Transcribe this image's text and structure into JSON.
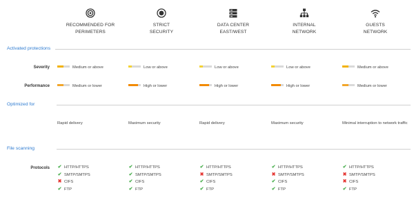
{
  "colors": {
    "accent": "#2e7bd0",
    "severity_fill": "#f2b200",
    "severity_fill_low": "#f4d233",
    "performance_fill": "#f2a62b",
    "performance_fill_high": "#f28a00",
    "yes": "#4caf50",
    "no": "#e53935"
  },
  "profiles": [
    {
      "icon": "target-icon",
      "title": "RECOMMENDED FOR\nPERIMETERS"
    },
    {
      "icon": "shield-circle-icon",
      "title": "STRICT\nSECURITY"
    },
    {
      "icon": "server-icon",
      "title": "DATA CENTER\nEAST/WEST"
    },
    {
      "icon": "network-hierarchy-icon",
      "title": "INTERNAL\nNETWORK"
    },
    {
      "icon": "wifi-icon",
      "title": "GUESTS\nNETWORK"
    }
  ],
  "sections": {
    "activated_protections": "Activated protections",
    "optimized_for": "Optimized for",
    "file_scanning": "File scanning"
  },
  "rows": {
    "severity": {
      "label": "Severity",
      "values": [
        {
          "text": "Medium or above",
          "level": 0.5
        },
        {
          "text": "Low or above",
          "level": 0.25
        },
        {
          "text": "Low or above",
          "level": 0.25
        },
        {
          "text": "Low or above",
          "level": 0.25
        },
        {
          "text": "Medium or above",
          "level": 0.5
        }
      ]
    },
    "performance": {
      "label": "Performance",
      "values": [
        {
          "text": "Medium or lower",
          "level": 0.5
        },
        {
          "text": "High or lower",
          "level": 0.75
        },
        {
          "text": "High or lower",
          "level": 0.75
        },
        {
          "text": "High or lower",
          "level": 0.75
        },
        {
          "text": "Medium or lower",
          "level": 0.5
        }
      ]
    },
    "optimized": [
      "Rapid delivery",
      "Maximum security",
      "Rapid delivery",
      "Maximum security",
      "Minimal interruption to network traffic"
    ],
    "protocols": {
      "label": "Protocols",
      "values": [
        [
          {
            "name": "HTTP/HTTPS",
            "enabled": true
          },
          {
            "name": "SMTP/SMTPS",
            "enabled": true
          },
          {
            "name": "CIFS",
            "enabled": false
          },
          {
            "name": "FTP",
            "enabled": true
          }
        ],
        [
          {
            "name": "HTTP/HTTPS",
            "enabled": true
          },
          {
            "name": "SMTP/SMTPS",
            "enabled": true
          },
          {
            "name": "CIFS",
            "enabled": true
          },
          {
            "name": "FTP",
            "enabled": true
          }
        ],
        [
          {
            "name": "HTTP/HTTPS",
            "enabled": true
          },
          {
            "name": "SMTP/SMTPS",
            "enabled": false
          },
          {
            "name": "CIFS",
            "enabled": true
          },
          {
            "name": "FTP",
            "enabled": true
          }
        ],
        [
          {
            "name": "HTTP/HTTPS",
            "enabled": true
          },
          {
            "name": "SMTP/SMTPS",
            "enabled": false
          },
          {
            "name": "CIFS",
            "enabled": true
          },
          {
            "name": "FTP",
            "enabled": true
          }
        ],
        [
          {
            "name": "HTTP/HTTPS",
            "enabled": true
          },
          {
            "name": "SMTP/SMTPS",
            "enabled": false
          },
          {
            "name": "CIFS",
            "enabled": false
          },
          {
            "name": "FTP",
            "enabled": true
          }
        ]
      ]
    }
  }
}
